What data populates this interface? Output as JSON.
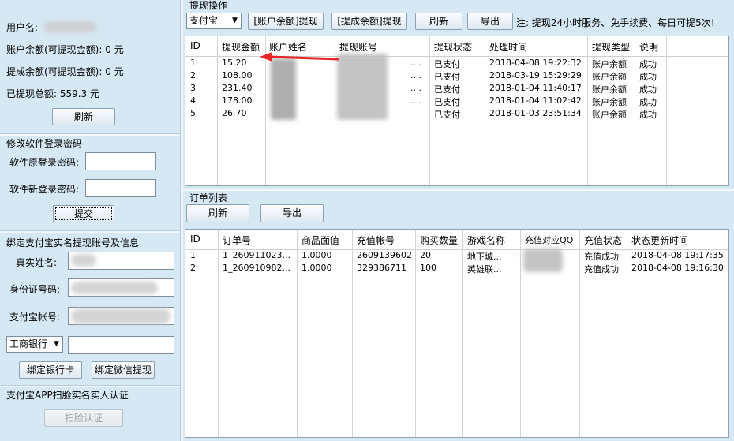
{
  "account": {
    "username_label": "用户名:",
    "balance_label": "账户余额(可提现金额):",
    "balance_value": "0 元",
    "withdraw_balance_label": "提成余额(可提现金额):",
    "withdraw_balance_value": "0 元",
    "total_label": "已提现总额:",
    "total_value": "559.3 元",
    "refresh_label": "刷新"
  },
  "password": {
    "section_title": "修改软件登录密码",
    "old_label": "软件原登录密码:",
    "new_label": "软件新登录密码:",
    "submit_label": "提交"
  },
  "bind": {
    "section_title": "绑定支付宝实名提现账号及信息",
    "name_label": "真实姓名:",
    "id_label": "身份证号码:",
    "alipay_label": "支付宝帐号:",
    "bank_selected": "工商银行",
    "bind_bank_label": "绑定银行卡",
    "bind_wechat_label": "绑定微信提现"
  },
  "face": {
    "section_title": "支付宝APP扫脸实名实人认证",
    "scan_label": "扫脸认证"
  },
  "withdraw": {
    "section_title": "提现操作",
    "method_selected": "支付宝",
    "btn_account": "[账户余额]提现",
    "btn_commission": "[提成余额]提现",
    "btn_refresh": "刷新",
    "btn_export": "导出",
    "note": "注: 提现24小时服务、免手续费、每日可提5次!",
    "columns": [
      "ID",
      "提现金额",
      "账户姓名",
      "提现账号",
      "提现状态",
      "处理时间",
      "提现类型",
      "说明"
    ],
    "rows": [
      {
        "id": "1",
        "amount": "15.20",
        "name": "",
        "acct": ".. .",
        "status": "已支付",
        "time": "2018-04-08 19:22:32",
        "type": "账户余额",
        "note": "成功"
      },
      {
        "id": "2",
        "amount": "108.00",
        "name": "",
        "acct": ".. .",
        "status": "已支付",
        "time": "2018-03-19 15:29:29",
        "type": "账户余额",
        "note": "成功"
      },
      {
        "id": "3",
        "amount": "231.40",
        "name": "",
        "acct": ".. .",
        "status": "已支付",
        "time": "2018-01-04 11:40:17",
        "type": "账户余额",
        "note": "成功"
      },
      {
        "id": "4",
        "amount": "178.00",
        "name": "",
        "acct": ".. .",
        "status": "已支付",
        "time": "2018-01-04 11:02:42",
        "type": "账户余额",
        "note": "成功"
      },
      {
        "id": "5",
        "amount": "26.70",
        "name": "",
        "acct": "",
        "status": "已支付",
        "time": "2018-01-03 23:51:34",
        "type": "账户余额",
        "note": "成功"
      }
    ]
  },
  "orders": {
    "section_title": "订单列表",
    "btn_refresh": "刷新",
    "btn_export": "导出",
    "columns": [
      "ID",
      "订单号",
      "商品面值",
      "充值帐号",
      "购买数量",
      "游戏名称",
      "充值对应QQ",
      "充值状态",
      "状态更新时间"
    ],
    "rows": [
      {
        "id": "1",
        "order": "1_260911023...",
        "face": "1.0000",
        "acct": "2609139602",
        "qty": "20",
        "game": "地下城...",
        "qq": "",
        "status": "充值成功",
        "time": "2018-04-08 19:17:35"
      },
      {
        "id": "2",
        "order": "1_260910982...",
        "face": "1.0000",
        "acct": "329386711",
        "qty": "100",
        "game": "英雄联...",
        "qq": "",
        "status": "充值成功",
        "time": "2018-04-08 19:16:30"
      }
    ]
  }
}
